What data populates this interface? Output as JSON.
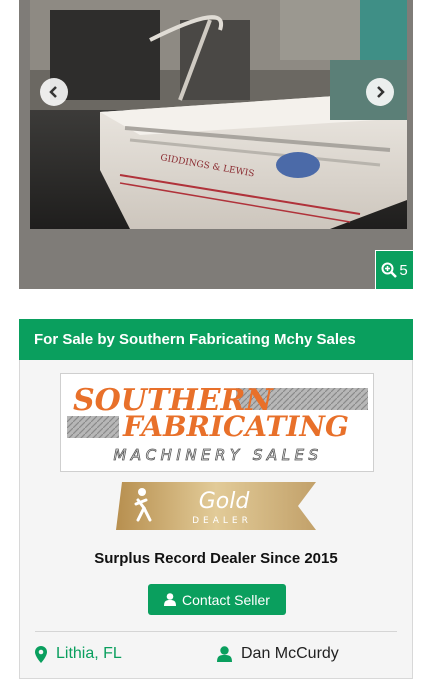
{
  "gallery": {
    "photo_count": "5",
    "photo_alt": "Giddings & Lewis machine",
    "machine_brand_text": "GIDDINGS & LEWIS",
    "prev_icon": "chevron-left-icon",
    "next_icon": "chevron-right-icon",
    "zoom_icon": "zoom-in-icon"
  },
  "seller": {
    "header": "For Sale by Southern Fabricating Mchy Sales",
    "logo": {
      "line1": "SOUTHERN",
      "line2": "FABRICATING",
      "line3": "MACHINERY SALES"
    },
    "badge": {
      "level": "Gold",
      "label": "DEALER"
    },
    "since": "Surplus Record Dealer Since 2015",
    "contact_button": "Contact Seller",
    "location": "Lithia, FL",
    "contact_name": "Dan McCurdy"
  },
  "colors": {
    "accent": "#0a9f5e",
    "logo_orange": "#e8702a",
    "gold": "#c9a96a"
  }
}
